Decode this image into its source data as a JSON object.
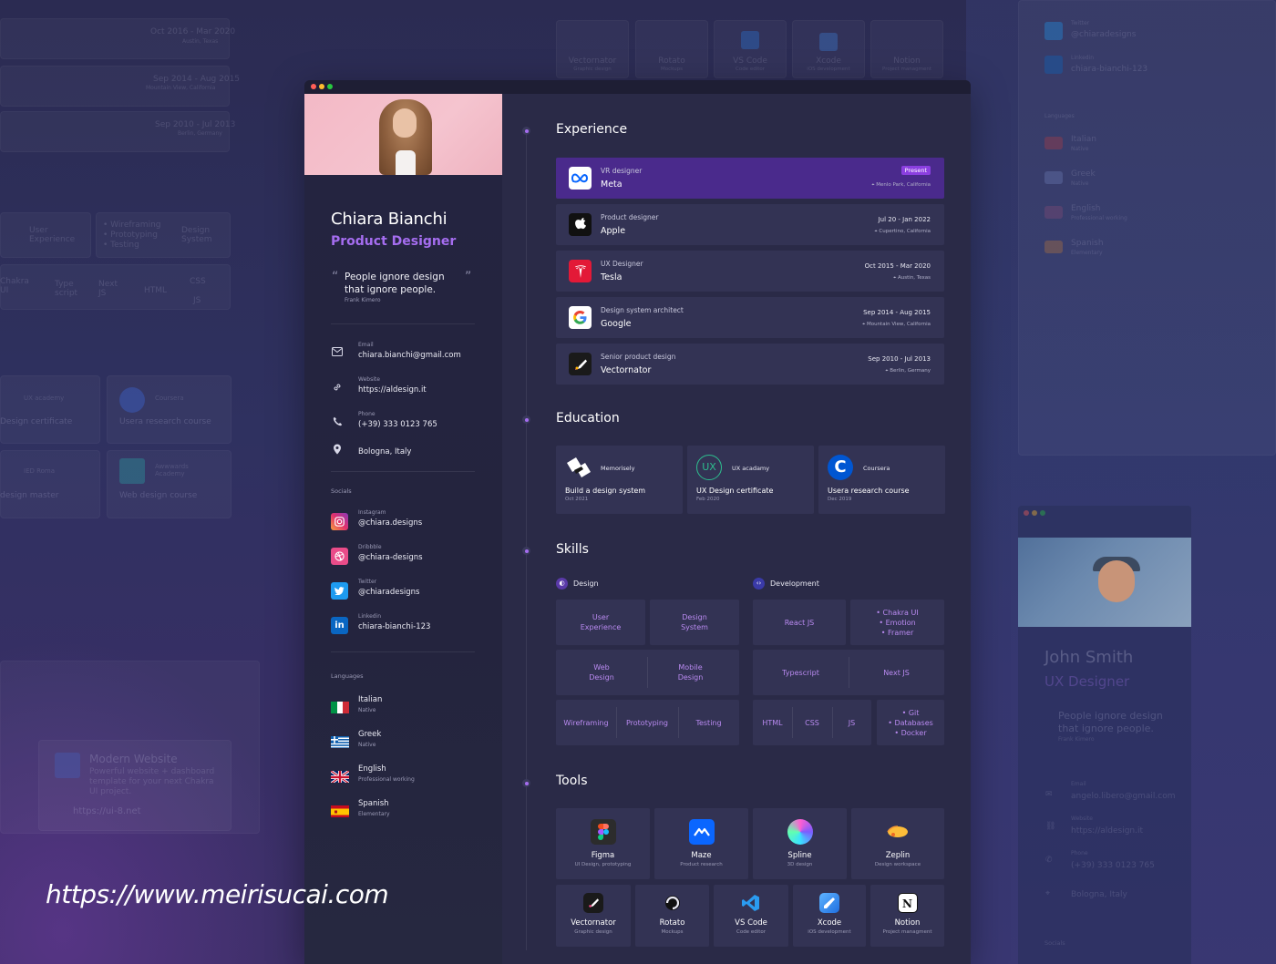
{
  "background": {
    "left_ghost": {
      "dates": [
        "Oct 2016 - Mar 2020",
        "Sep 2014 - Aug 2015",
        "Sep 2010 - Jul 2013"
      ],
      "locations": [
        "Austin, Texas",
        "Mountain View, California",
        "Berlin, Germany"
      ],
      "skills": [
        "User Experience",
        "Wireframing",
        "Prototyping",
        "Testing",
        "Design System",
        "Chakra UI",
        "Type script",
        "Next JS",
        "HTML",
        "CSS",
        "JS"
      ],
      "edu": [
        "UX academy",
        "Design certificate",
        "Coursera",
        "Usera research course",
        "IED Roma",
        "design master",
        "Awwwards Academy",
        "Web design course"
      ],
      "project_title": "Modern Website",
      "project_desc": "Powerful website + dashboard template for your next Chakra UI project.",
      "project_link": "https://ui-8.net"
    },
    "top_ghost_tools": [
      {
        "name": "Vectornator",
        "sub": "Graphic design"
      },
      {
        "name": "Rotato",
        "sub": "Mockups"
      },
      {
        "name": "VS Code",
        "sub": "Code editor"
      },
      {
        "name": "Xcode",
        "sub": "iOS development"
      },
      {
        "name": "Notion",
        "sub": "Project managment"
      }
    ],
    "right_ghost": {
      "socials": [
        {
          "label": "Twitter",
          "value": "@chiaradesigns"
        },
        {
          "label": "Linkedin",
          "value": "chiara-bianchi-123"
        }
      ],
      "languages_label": "Languages",
      "languages": [
        {
          "name": "Italian",
          "level": "Native"
        },
        {
          "name": "Greek",
          "level": "Native"
        },
        {
          "name": "English",
          "level": "Professional working"
        },
        {
          "name": "Spanish",
          "level": "Elementary"
        }
      ]
    },
    "preview": {
      "name": "John Smith",
      "role": "UX Designer",
      "quote": "People ignore design that ignore people.",
      "quote_author": "Frank Kimero",
      "email_label": "Email",
      "email": "angelo.libero@gmail.com",
      "website_label": "Website",
      "website": "https://aldesign.it",
      "phone_label": "Phone",
      "phone": "(+39) 333 0123 765",
      "location": "Bologna, Italy",
      "socials_label": "Socials"
    }
  },
  "window_dots": [
    "#ff5f57",
    "#febc2e",
    "#28c840"
  ],
  "profile": {
    "name": "Chiara Bianchi",
    "role": "Product Designer",
    "quote": "People ignore design that ignore people.",
    "quote_author": "Frank Kimero",
    "contacts": [
      {
        "icon": "mail-icon",
        "label": "Email",
        "value": "chiara.bianchi@gmail.com"
      },
      {
        "icon": "link-icon",
        "label": "Website",
        "value": "https://aldesign.it"
      },
      {
        "icon": "phone-icon",
        "label": "Phone",
        "value": "(+39) 333 0123 765"
      },
      {
        "icon": "location-pin-icon",
        "label": "",
        "value": "Bologna, Italy"
      }
    ],
    "socials_label": "Socials",
    "socials": [
      {
        "icon": "instagram-icon",
        "label": "Instagram",
        "value": "@chiara.designs",
        "color": "#e1306c"
      },
      {
        "icon": "dribbble-icon",
        "label": "Dribbble",
        "value": "@chiara-designs",
        "color": "#ea4c89"
      },
      {
        "icon": "twitter-icon",
        "label": "Twitter",
        "value": "@chiaradesigns",
        "color": "#1d9bf0"
      },
      {
        "icon": "linkedin-icon",
        "label": "Linkedin",
        "value": "chiara-bianchi-123",
        "color": "#0a66c2"
      }
    ],
    "languages_label": "Languages",
    "languages": [
      {
        "flag": "italy-flag-icon",
        "name": "Italian",
        "level": "Native"
      },
      {
        "flag": "greece-flag-icon",
        "name": "Greek",
        "level": "Native"
      },
      {
        "flag": "uk-flag-icon",
        "name": "English",
        "level": "Professional working"
      },
      {
        "flag": "spain-flag-icon",
        "name": "Spanish",
        "level": "Elementary"
      }
    ]
  },
  "experience": {
    "title": "Experience",
    "items": [
      {
        "logo": "meta-logo-icon",
        "title": "VR designer",
        "company": "Meta",
        "dates": "",
        "badge": "Present",
        "location": "Menlo Park, California",
        "active": true
      },
      {
        "logo": "apple-logo-icon",
        "title": "Product designer",
        "company": "Apple",
        "dates": "Jul 20 - Jan 2022",
        "badge": "",
        "location": "Cupertino, California",
        "active": false
      },
      {
        "logo": "tesla-logo-icon",
        "title": "UX Designer",
        "company": "Tesla",
        "dates": "Oct 2015 - Mar 2020",
        "badge": "",
        "location": "Austin, Texas",
        "active": false
      },
      {
        "logo": "google-logo-icon",
        "title": "Design system architect",
        "company": "Google",
        "dates": "Sep 2014 - Aug 2015",
        "badge": "",
        "location": "Mountain View, California",
        "active": false
      },
      {
        "logo": "vectornator-logo-icon",
        "title": "Senior product design",
        "company": "Vectornator",
        "dates": "Sep 2010 - Jul 2013",
        "badge": "",
        "location": "Berlin, Germany",
        "active": false
      }
    ]
  },
  "education": {
    "title": "Education",
    "items": [
      {
        "logo": "memorisely-logo-icon",
        "institution": "Memorisely",
        "course": "Build a design system",
        "date": "Oct 2021"
      },
      {
        "logo": "ux-academy-logo-icon",
        "institution": "UX acadamy",
        "course": "UX Design certificate",
        "date": "Feb 2020",
        "logo_text": "UX"
      },
      {
        "logo": "coursera-logo-icon",
        "institution": "Coursera",
        "course": "Usera research course",
        "date": "Dec 2019",
        "logo_text": "C"
      }
    ]
  },
  "skills": {
    "title": "Skills",
    "design": {
      "label": "Design",
      "rows": [
        [
          "User\nExperience",
          "Design\nSystem"
        ],
        [
          "Web\nDesign",
          "Mobile\nDesign"
        ],
        [
          "Wireframing",
          "Prototyping",
          "Testing"
        ]
      ]
    },
    "development": {
      "label": "Development",
      "rows": [
        [
          "React JS",
          "• Chakra UI\n• Emotion\n• Framer"
        ],
        [
          "Typescript",
          "Next JS"
        ],
        [
          "HTML",
          "CSS",
          "JS",
          "• Git\n• Databases\n• Docker"
        ]
      ]
    }
  },
  "tools": {
    "title": "Tools",
    "row1": [
      {
        "icon": "figma-icon",
        "name": "Figma",
        "sub": "UI Design, prototyping"
      },
      {
        "icon": "maze-icon",
        "name": "Maze",
        "sub": "Product research"
      },
      {
        "icon": "spline-icon",
        "name": "Spline",
        "sub": "3D design"
      },
      {
        "icon": "zeplin-icon",
        "name": "Zeplin",
        "sub": "Design workspace"
      }
    ],
    "row2": [
      {
        "icon": "vectornator-icon",
        "name": "Vectornator",
        "sub": "Graphic design"
      },
      {
        "icon": "rotato-icon",
        "name": "Rotato",
        "sub": "Mockups"
      },
      {
        "icon": "vscode-icon",
        "name": "VS Code",
        "sub": "Code editor"
      },
      {
        "icon": "xcode-icon",
        "name": "Xcode",
        "sub": "iOS development"
      },
      {
        "icon": "notion-icon",
        "name": "Notion",
        "sub": "Project managment"
      }
    ]
  },
  "watermark": "https://www.meirisucai.com"
}
